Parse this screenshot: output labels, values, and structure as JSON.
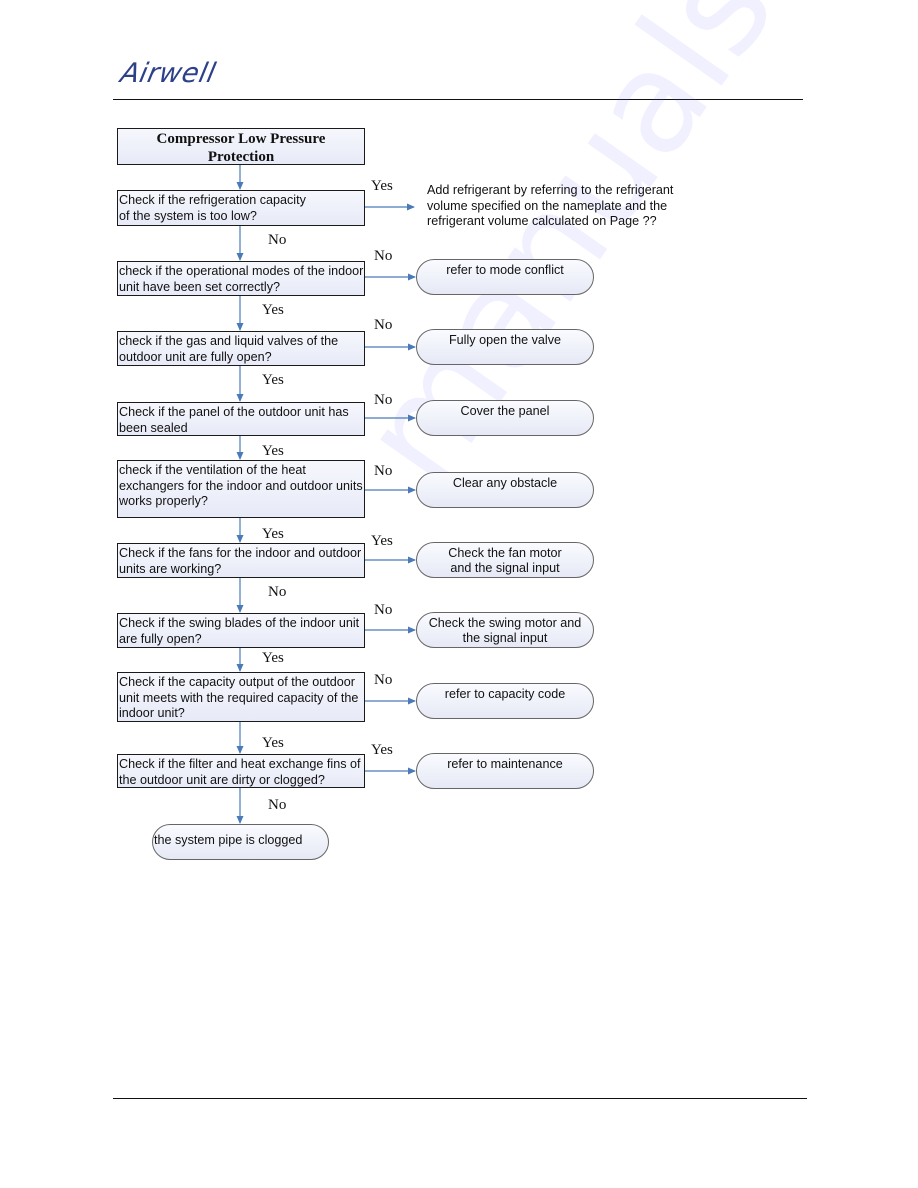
{
  "header": {
    "brand": "Airwell"
  },
  "watermark": "manualshive.com",
  "flowchart": {
    "title": "Compressor Low Pressure\nProtection",
    "steps": [
      {
        "question": "Check if the refrigeration capacity\nof the system is too low?",
        "branch_label": "Yes",
        "action": "Add refrigerant by referring to the refrigerant\nvolume specified on the nameplate and the\nrefrigerant volume calculated on Page ??",
        "next_label": "No"
      },
      {
        "question": "check if the operational modes of the indoor\nunit have been set correctly?",
        "branch_label": "No",
        "action": "refer to mode conflict",
        "next_label": "Yes"
      },
      {
        "question": "check if the gas and liquid valves of the\noutdoor unit are fully open?",
        "branch_label": "No",
        "action": "Fully open the valve",
        "next_label": "Yes"
      },
      {
        "question": "Check if the panel of the outdoor unit has\nbeen sealed",
        "branch_label": "No",
        "action": "Cover the panel",
        "next_label": "Yes"
      },
      {
        "question": "check if the ventilation of the heat\nexchangers for the indoor and outdoor units\nworks properly?",
        "branch_label": "No",
        "action": "Clear any obstacle",
        "next_label": "Yes"
      },
      {
        "question": "Check if the fans for the indoor and outdoor\nunits are working?",
        "branch_label": "Yes",
        "action": "Check the fan motor\nand the signal input",
        "next_label": "No"
      },
      {
        "question": "Check if the swing blades of the indoor unit\nare fully open?",
        "branch_label": "No",
        "action": "Check the swing motor and\nthe signal input",
        "next_label": "Yes"
      },
      {
        "question": "Check if the capacity output of the outdoor\nunit meets with the required capacity of the\nindoor unit?",
        "branch_label": "No",
        "action": "refer to capacity code",
        "next_label": "Yes"
      },
      {
        "question": "Check if the filter and heat exchange fins of\nthe outdoor  unit are dirty or clogged?",
        "branch_label": "Yes",
        "action": "refer to maintenance",
        "next_label": "No"
      }
    ],
    "end": "the system pipe is clogged"
  },
  "colors": {
    "connector": "#4a7ab8",
    "logo": "#2d4189"
  }
}
